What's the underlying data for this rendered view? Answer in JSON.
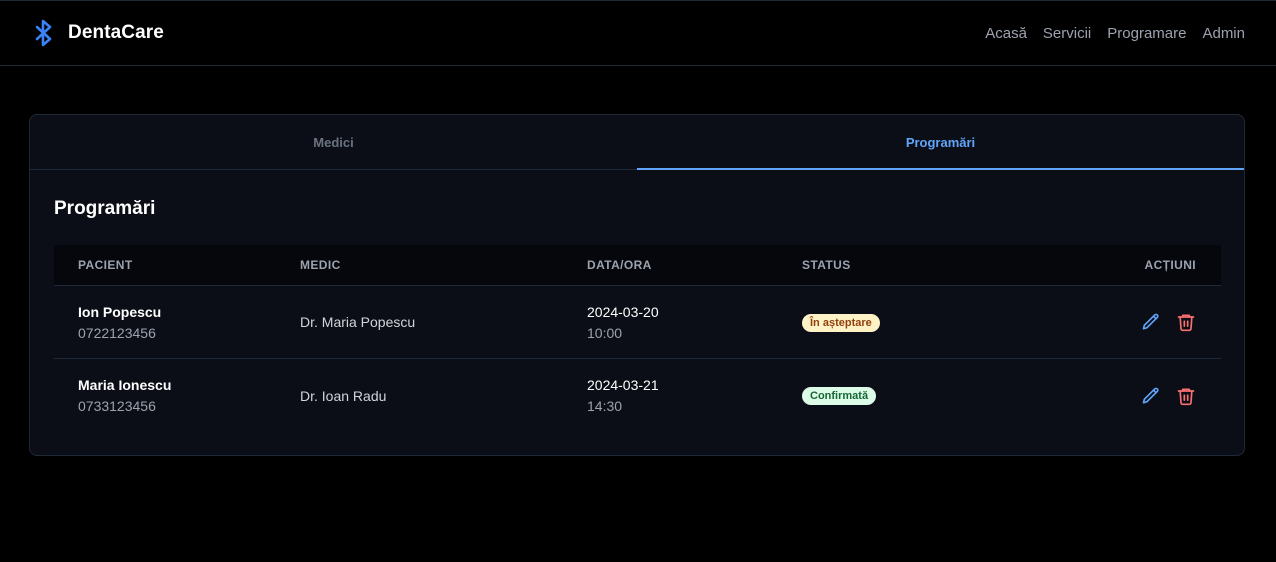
{
  "nav": {
    "brand": "DentaCare",
    "brand_icon": "bluetooth-icon",
    "links": [
      "Acasă",
      "Servicii",
      "Programare",
      "Admin"
    ]
  },
  "tabs": [
    {
      "label": "Medici",
      "active": false
    },
    {
      "label": "Programări",
      "active": true
    }
  ],
  "section": {
    "title": "Programări"
  },
  "table": {
    "headers": [
      "PACIENT",
      "MEDIC",
      "DATA/ORA",
      "STATUS",
      "ACȚIUNI"
    ],
    "rows": [
      {
        "patient": "Ion Popescu",
        "phone": "0722123456",
        "medic": "Dr. Maria Popescu",
        "date": "2024-03-20",
        "time": "10:00",
        "status": "În așteptare",
        "status_type": "pending"
      },
      {
        "patient": "Maria Ionescu",
        "phone": "0733123456",
        "medic": "Dr. Ioan Radu",
        "date": "2024-03-21",
        "time": "14:30",
        "status": "Confirmată",
        "status_type": "confirmed"
      }
    ],
    "actions": [
      "edit-icon",
      "trash-icon"
    ]
  },
  "colors": {
    "accent": "#60a5fa",
    "danger": "#f87171",
    "pending_bg": "#fef3c7",
    "confirmed_bg": "#dcfce7"
  }
}
